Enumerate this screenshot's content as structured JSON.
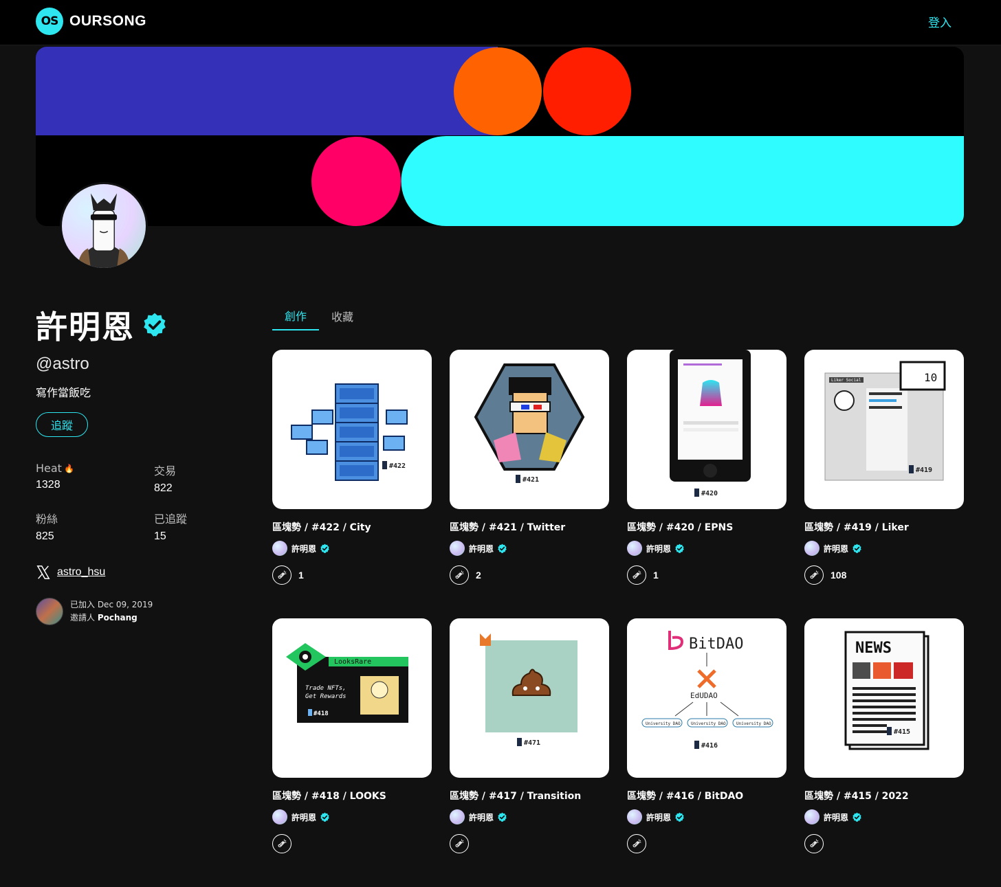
{
  "header": {
    "logo_mark": "OS",
    "logo_text": "OURSONG",
    "login_label": "登入"
  },
  "colors": {
    "accent": "#2ee6f0",
    "banner_blue": "#3530b8",
    "banner_orange": "#ff6200",
    "banner_red": "#ff1e00",
    "banner_pink": "#ff0066",
    "banner_cyan": "#2ffcff"
  },
  "profile": {
    "name": "許明恩",
    "handle": "@astro",
    "bio": "寫作當飯吃",
    "follow_label": "追蹤",
    "stats": [
      {
        "label": "Heat",
        "value": "1328",
        "flame": true
      },
      {
        "label": "交易",
        "value": "822",
        "flame": false
      },
      {
        "label": "粉絲",
        "value": "825",
        "flame": false
      },
      {
        "label": "已追蹤",
        "value": "15",
        "flame": false
      }
    ],
    "twitter": "astro_hsu",
    "joined": "已加入 Dec 09, 2019",
    "invited_prefix": "邀請人",
    "inviter": "Pochang"
  },
  "tabs": [
    {
      "label": "創作",
      "active": true
    },
    {
      "label": "收藏",
      "active": false
    }
  ],
  "cards": [
    {
      "title": "區塊勢 / #422 / City",
      "author": "許明恩",
      "likes": "1",
      "art": "city",
      "num": "#422"
    },
    {
      "title": "區塊勢 / #421 / Twitter",
      "author": "許明恩",
      "likes": "2",
      "art": "twitter",
      "num": "#421"
    },
    {
      "title": "區塊勢 / #420 / EPNS",
      "author": "許明恩",
      "likes": "1",
      "art": "epns",
      "num": "#420"
    },
    {
      "title": "區塊勢 / #419 / Liker",
      "author": "許明恩",
      "likes": "108",
      "art": "liker",
      "num": "#419",
      "extra": "Liker Social",
      "bubble": "10"
    },
    {
      "title": "區塊勢 / #418 / LOOKS",
      "author": "許明恩",
      "likes": "",
      "art": "looks",
      "num": "#418",
      "extra": "LooksRare",
      "extra2": "Trade NFTs,",
      "extra3": "Get Rewards"
    },
    {
      "title": "區塊勢 / #417 / Transition",
      "author": "許明恩",
      "likes": "",
      "art": "poop",
      "num": "#471"
    },
    {
      "title": "區塊勢 / #416 / BitDAO",
      "author": "許明恩",
      "likes": "",
      "art": "bitdao",
      "num": "#416",
      "extra": "BitDAO",
      "extra2": "EdUDAO",
      "extra3": "University DAO"
    },
    {
      "title": "區塊勢 / #415 / 2022",
      "author": "許明恩",
      "likes": "",
      "art": "news",
      "num": "#415",
      "extra": "NEWS"
    }
  ]
}
